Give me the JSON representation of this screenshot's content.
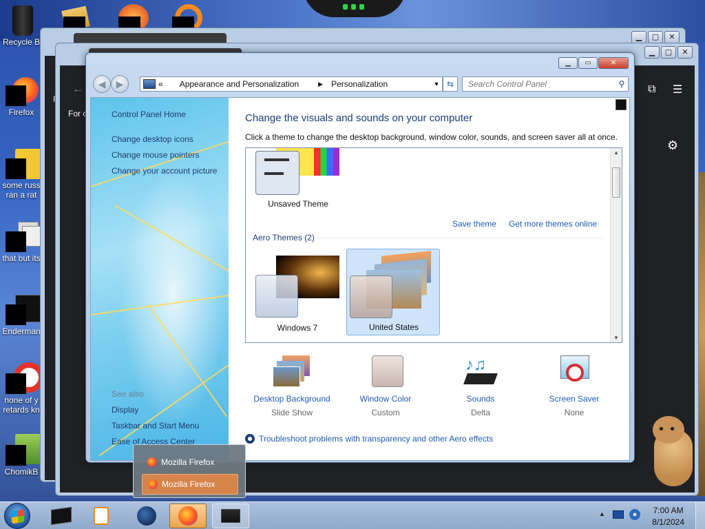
{
  "desktop": {
    "icons": [
      {
        "label": "Recycle Bin",
        "display": "Recycle B"
      },
      {
        "label": "Firefox",
        "display": "Firefox"
      },
      {
        "label": "some russ ran a rat",
        "display_lines": [
          "some russ",
          "ran a rat"
        ]
      },
      {
        "label": "that but its",
        "display": "that but its"
      },
      {
        "label": "Enderman",
        "display": "Enderman"
      },
      {
        "label": "none of y retards kn",
        "display_lines": [
          "none of y",
          "retards kn"
        ]
      },
      {
        "label": "ChomikB",
        "display": "ChomikB"
      }
    ]
  },
  "bg_window": {
    "left_partial_text": "F",
    "for_text": "For c"
  },
  "control_panel": {
    "breadcrumb": {
      "overflow": "«",
      "items": [
        "Appearance and Personalization",
        "Personalization"
      ]
    },
    "search_placeholder": "Search Control Panel",
    "left_pane": {
      "home": "Control Panel Home",
      "links": [
        "Change desktop icons",
        "Change mouse pointers",
        "Change your account picture"
      ],
      "see_also_label": "See also",
      "see_also": [
        "Display",
        "Taskbar and Start Menu",
        "Ease of Access Center"
      ]
    },
    "heading": "Change the visuals and sounds on your computer",
    "subheading": "Click a theme to change the desktop background, window color, sounds, and screen saver all at once.",
    "unsaved_theme": "Unsaved Theme",
    "save_theme": "Save theme",
    "get_more": "Get more themes online",
    "aero_group": "Aero Themes (2)",
    "themes": [
      "Windows 7",
      "United States"
    ],
    "selected_theme": "United States",
    "bottom": [
      {
        "title": "Desktop Background",
        "value": "Slide Show"
      },
      {
        "title": "Window Color",
        "value": "Custom"
      },
      {
        "title": "Sounds",
        "value": "Delta"
      },
      {
        "title": "Screen Saver",
        "value": "None"
      }
    ],
    "troubleshoot": "Troubleshoot problems with transparency and other Aero effects"
  },
  "firefox_popup": {
    "items": [
      "Mozilla Firefox",
      "Mozilla Firefox"
    ],
    "selected_index": 1
  },
  "taskbar": {
    "time": "7:00 AM",
    "date": "8/1/2024",
    "active_app": "firefox-icon"
  },
  "colors": {
    "link": "#1e5bb0",
    "heading": "#1d3c78",
    "selection": "#cfe3fa",
    "taskbar_active": "#e9a54c"
  }
}
